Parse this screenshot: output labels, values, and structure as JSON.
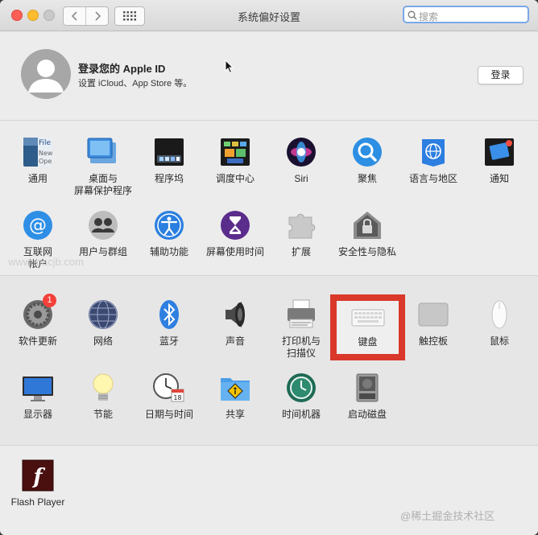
{
  "window": {
    "title": "系统偏好设置"
  },
  "search": {
    "placeholder": "搜索"
  },
  "account": {
    "title": "登录您的 Apple ID",
    "subtitle": "设置 iCloud、App Store 等。",
    "login_label": "登录"
  },
  "section1": {
    "items": [
      {
        "label": "通用",
        "icon": "general-icon"
      },
      {
        "label": "桌面与\n屏幕保护程序",
        "icon": "desktop-icon"
      },
      {
        "label": "程序坞",
        "icon": "dock-icon"
      },
      {
        "label": "调度中心",
        "icon": "mission-control-icon"
      },
      {
        "label": "Siri",
        "icon": "siri-icon"
      },
      {
        "label": "聚焦",
        "icon": "spotlight-icon"
      },
      {
        "label": "语言与地区",
        "icon": "language-icon"
      },
      {
        "label": "通知",
        "icon": "notifications-icon"
      },
      {
        "label": "互联网\n帐户",
        "icon": "internet-accounts-icon"
      },
      {
        "label": "用户与群组",
        "icon": "users-icon"
      },
      {
        "label": "辅助功能",
        "icon": "accessibility-icon"
      },
      {
        "label": "屏幕使用时间",
        "icon": "screen-time-icon"
      },
      {
        "label": "扩展",
        "icon": "extensions-icon"
      },
      {
        "label": "安全性与隐私",
        "icon": "security-icon"
      }
    ]
  },
  "section2": {
    "items": [
      {
        "label": "软件更新",
        "icon": "software-update-icon",
        "badge": "1"
      },
      {
        "label": "网络",
        "icon": "network-icon"
      },
      {
        "label": "蓝牙",
        "icon": "bluetooth-icon"
      },
      {
        "label": "声音",
        "icon": "sound-icon"
      },
      {
        "label": "打印机与\n扫描仪",
        "icon": "printer-icon"
      },
      {
        "label": "键盘",
        "icon": "keyboard-icon"
      },
      {
        "label": "触控板",
        "icon": "trackpad-icon"
      },
      {
        "label": "鼠标",
        "icon": "mouse-icon"
      },
      {
        "label": "显示器",
        "icon": "display-icon"
      },
      {
        "label": "节能",
        "icon": "energy-icon"
      },
      {
        "label": "日期与时间",
        "icon": "date-time-icon"
      },
      {
        "label": "共享",
        "icon": "sharing-icon"
      },
      {
        "label": "时间机器",
        "icon": "time-machine-icon"
      },
      {
        "label": "启动磁盘",
        "icon": "startup-disk-icon"
      }
    ]
  },
  "section3": {
    "items": [
      {
        "label": "Flash Player",
        "icon": "flash-player-icon"
      }
    ]
  },
  "watermarks": {
    "left": "www.macjb.com",
    "right": "@稀土掘金技术社区"
  },
  "colors": {
    "highlight": "#d9382a",
    "badge": "#f5403a"
  }
}
